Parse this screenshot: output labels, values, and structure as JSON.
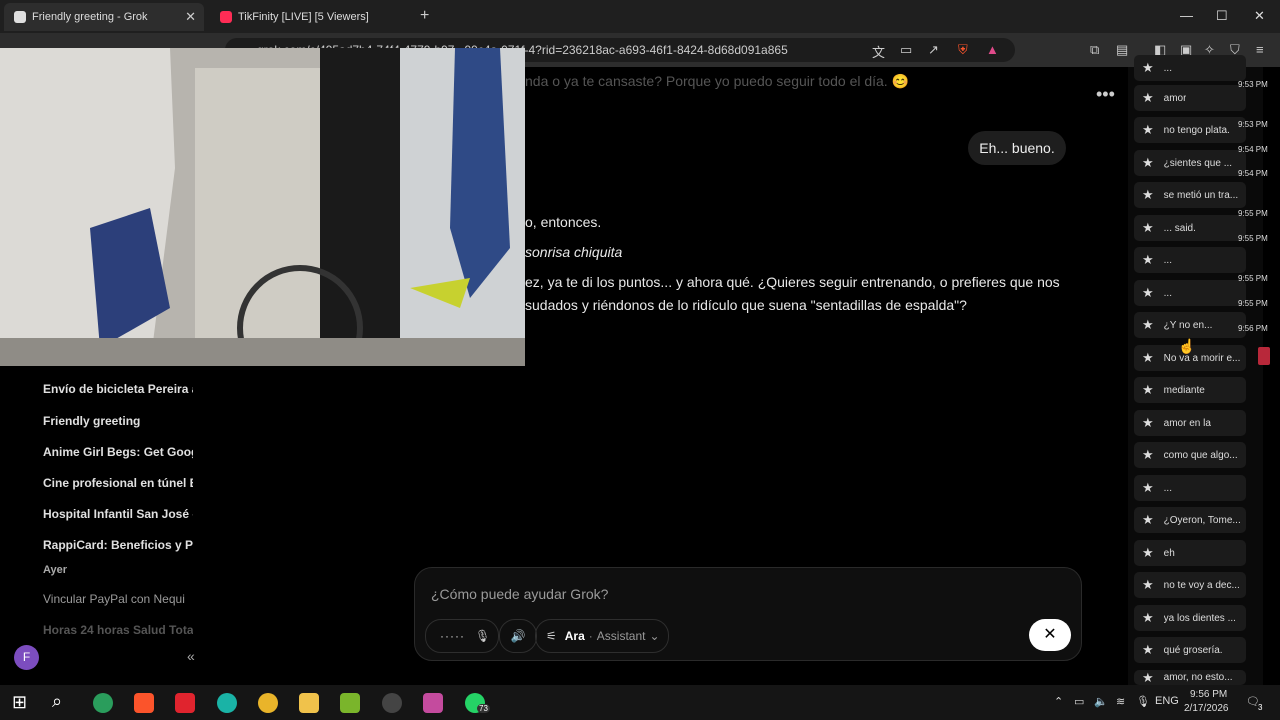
{
  "tabs": [
    {
      "title": "Friendly greeting - Grok"
    },
    {
      "title": "TikFinity [LIVE] [5 Viewers]"
    }
  ],
  "address": {
    "url": "grok.com/c/495ad7b4-74f4-4779-b97...99c4a-071f-4?rid=236218ac-a693-46f1-8424-8d68d091a865"
  },
  "sidebar": {
    "items": [
      "Envío de bicicleta Pereira a",
      "Friendly greeting",
      "Anime Girl Begs: Get Google",
      "Cine profesional en túnel Bo",
      "Hospital Infantil San José -",
      "RappiCard: Beneficios y Pro",
      "Vincular PayPal con Nequi",
      "Horas 24 horas Salud Total"
    ],
    "section_yesterday": "Ayer",
    "avatar_initial": "F",
    "collapse_glyph": "«"
  },
  "chat": {
    "line_top": "nda o ya te cansaste? Porque yo puedo seguir todo el día. 😊",
    "user_bubble": "Eh... bueno.",
    "line_entonces": "o, entonces.",
    "line_italic": "sonrisa chiquita",
    "line_para1": "ez, ya te di los puntos... y ahora qué. ¿Quieres seguir entrenando, o prefieres que nos",
    "line_para2": "sudados y riéndonos de lo ridículo que suena \"sentadillas de espalda\"?"
  },
  "composer": {
    "placeholder": "¿Cómo puede ayudar Grok?",
    "voice_name": "Ara",
    "voice_role": "Assistant",
    "close": "✕"
  },
  "right_panel": {
    "items": [
      "...",
      "amor",
      "no tengo plata.",
      "¿sientes que ...",
      "se metió un tra...",
      "... said.",
      "...",
      "...",
      "¿Y no en...",
      "No va a morir e...",
      "mediante",
      "amor en la",
      "como que algo...",
      "...",
      "¿Oyeron, Tome...",
      "eh",
      "no te voy a dec...",
      "ya los dientes ...",
      "qué grosería.",
      "amor, no esto..."
    ],
    "timestamps": [
      "9:53 PM",
      "9:53 PM",
      "9:54 PM",
      "9:54 PM",
      "9:55 PM",
      "9:55 PM",
      "9:55 PM",
      "9:55 PM",
      "9:56 PM"
    ]
  },
  "taskbar": {
    "whatsapp_badge": "73",
    "lang": "ENG",
    "time": "9:56 PM",
    "date": "2/17/2026",
    "notif_count": "3"
  },
  "colors": {
    "accent": "#7c4dbf",
    "tiktok": "#fe2c55",
    "brave": "#fb542b"
  }
}
